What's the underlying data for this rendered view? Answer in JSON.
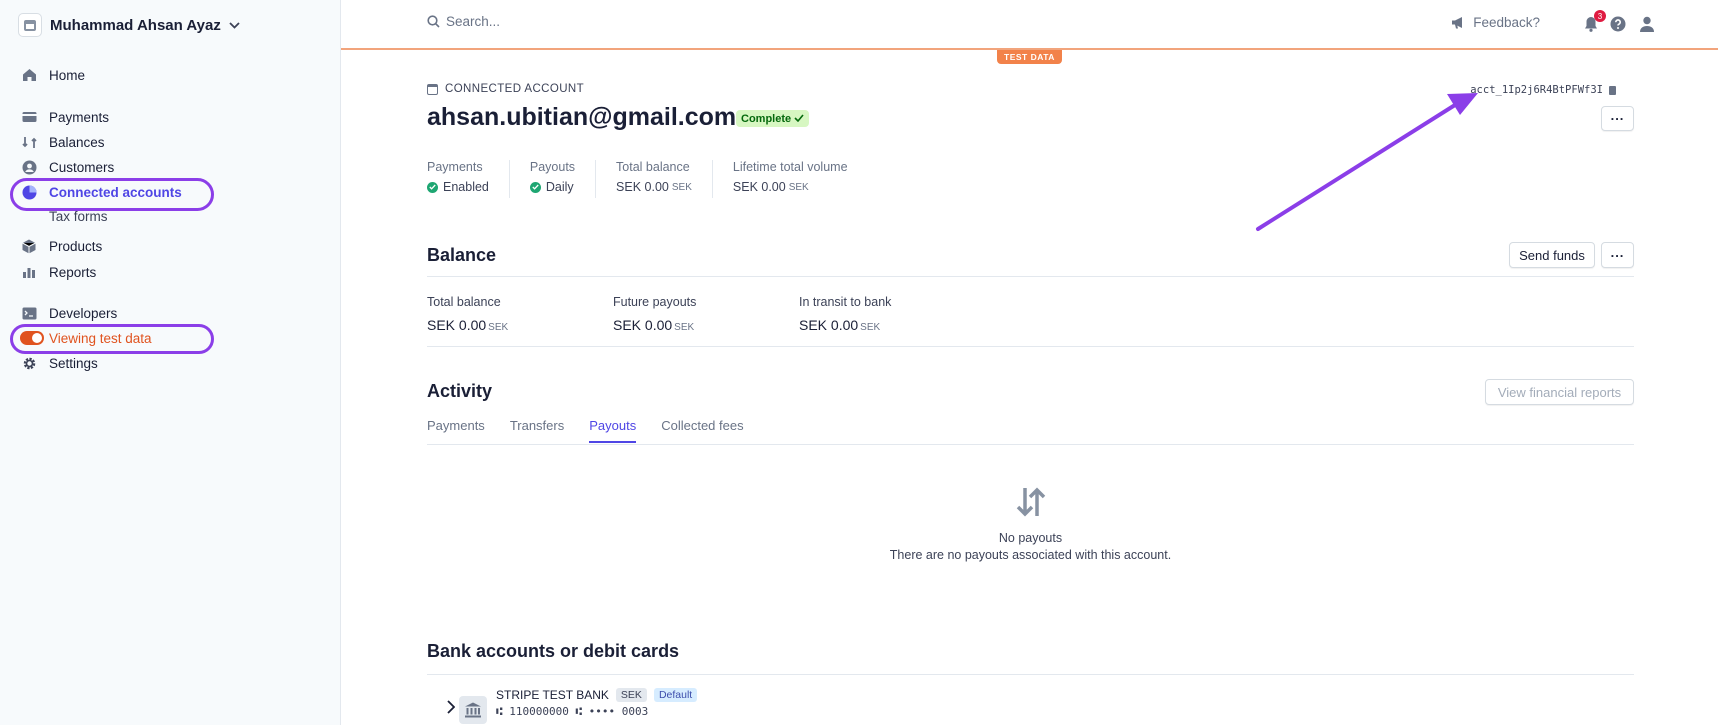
{
  "sidebar": {
    "account_name": "Muhammad Ahsan Ayaz",
    "items": [
      {
        "label": "Home",
        "icon": "home-icon"
      },
      {
        "label": "Payments",
        "icon": "payments-icon"
      },
      {
        "label": "Balances",
        "icon": "balances-icon"
      },
      {
        "label": "Customers",
        "icon": "customers-icon"
      },
      {
        "label": "Connected accounts",
        "icon": "connected-accounts-icon"
      },
      {
        "label": "Tax forms"
      },
      {
        "label": "Products",
        "icon": "products-icon"
      },
      {
        "label": "Reports",
        "icon": "reports-icon"
      },
      {
        "label": "Developers",
        "icon": "developers-icon"
      },
      {
        "label": "Viewing test data",
        "icon": "toggle-icon"
      },
      {
        "label": "Settings",
        "icon": "gear-icon"
      }
    ]
  },
  "topbar": {
    "search_placeholder": "Search...",
    "feedback_label": "Feedback?",
    "notification_count": "3",
    "test_badge": "TEST DATA"
  },
  "header": {
    "section_label": "CONNECTED ACCOUNT",
    "account_id": "acct_1Ip2j6R4BtPFWf3I",
    "email": "ahsan.ubitian@gmail.com",
    "status_badge": "Complete",
    "stats": [
      {
        "label": "Payments",
        "value": "Enabled"
      },
      {
        "label": "Payouts",
        "value": "Daily"
      },
      {
        "label": "Total balance",
        "value": "SEK 0.00",
        "currency": "SEK"
      },
      {
        "label": "Lifetime total volume",
        "value": "SEK 0.00",
        "currency": "SEK"
      }
    ]
  },
  "balance": {
    "title": "Balance",
    "send_funds_label": "Send funds",
    "cols": [
      {
        "label": "Total balance",
        "value": "SEK 0.00",
        "currency": "SEK"
      },
      {
        "label": "Future payouts",
        "value": "SEK 0.00",
        "currency": "SEK"
      },
      {
        "label": "In transit to bank",
        "value": "SEK 0.00",
        "currency": "SEK"
      }
    ]
  },
  "activity": {
    "title": "Activity",
    "reports_button": "View financial reports",
    "tabs": [
      "Payments",
      "Transfers",
      "Payouts",
      "Collected fees"
    ],
    "active_tab": "Payouts",
    "empty_title": "No payouts",
    "empty_text": "There are no payouts associated with this account."
  },
  "bank": {
    "title": "Bank accounts or debit cards",
    "name": "STRIPE TEST BANK",
    "currency": "SEK",
    "default_label": "Default",
    "number": "⑆ 110000000 ⑆ •••• 0003"
  },
  "colors": {
    "accent": "#4f46e5",
    "test_orange": "#e0531f",
    "annotation_purple": "#8b3ee8"
  }
}
